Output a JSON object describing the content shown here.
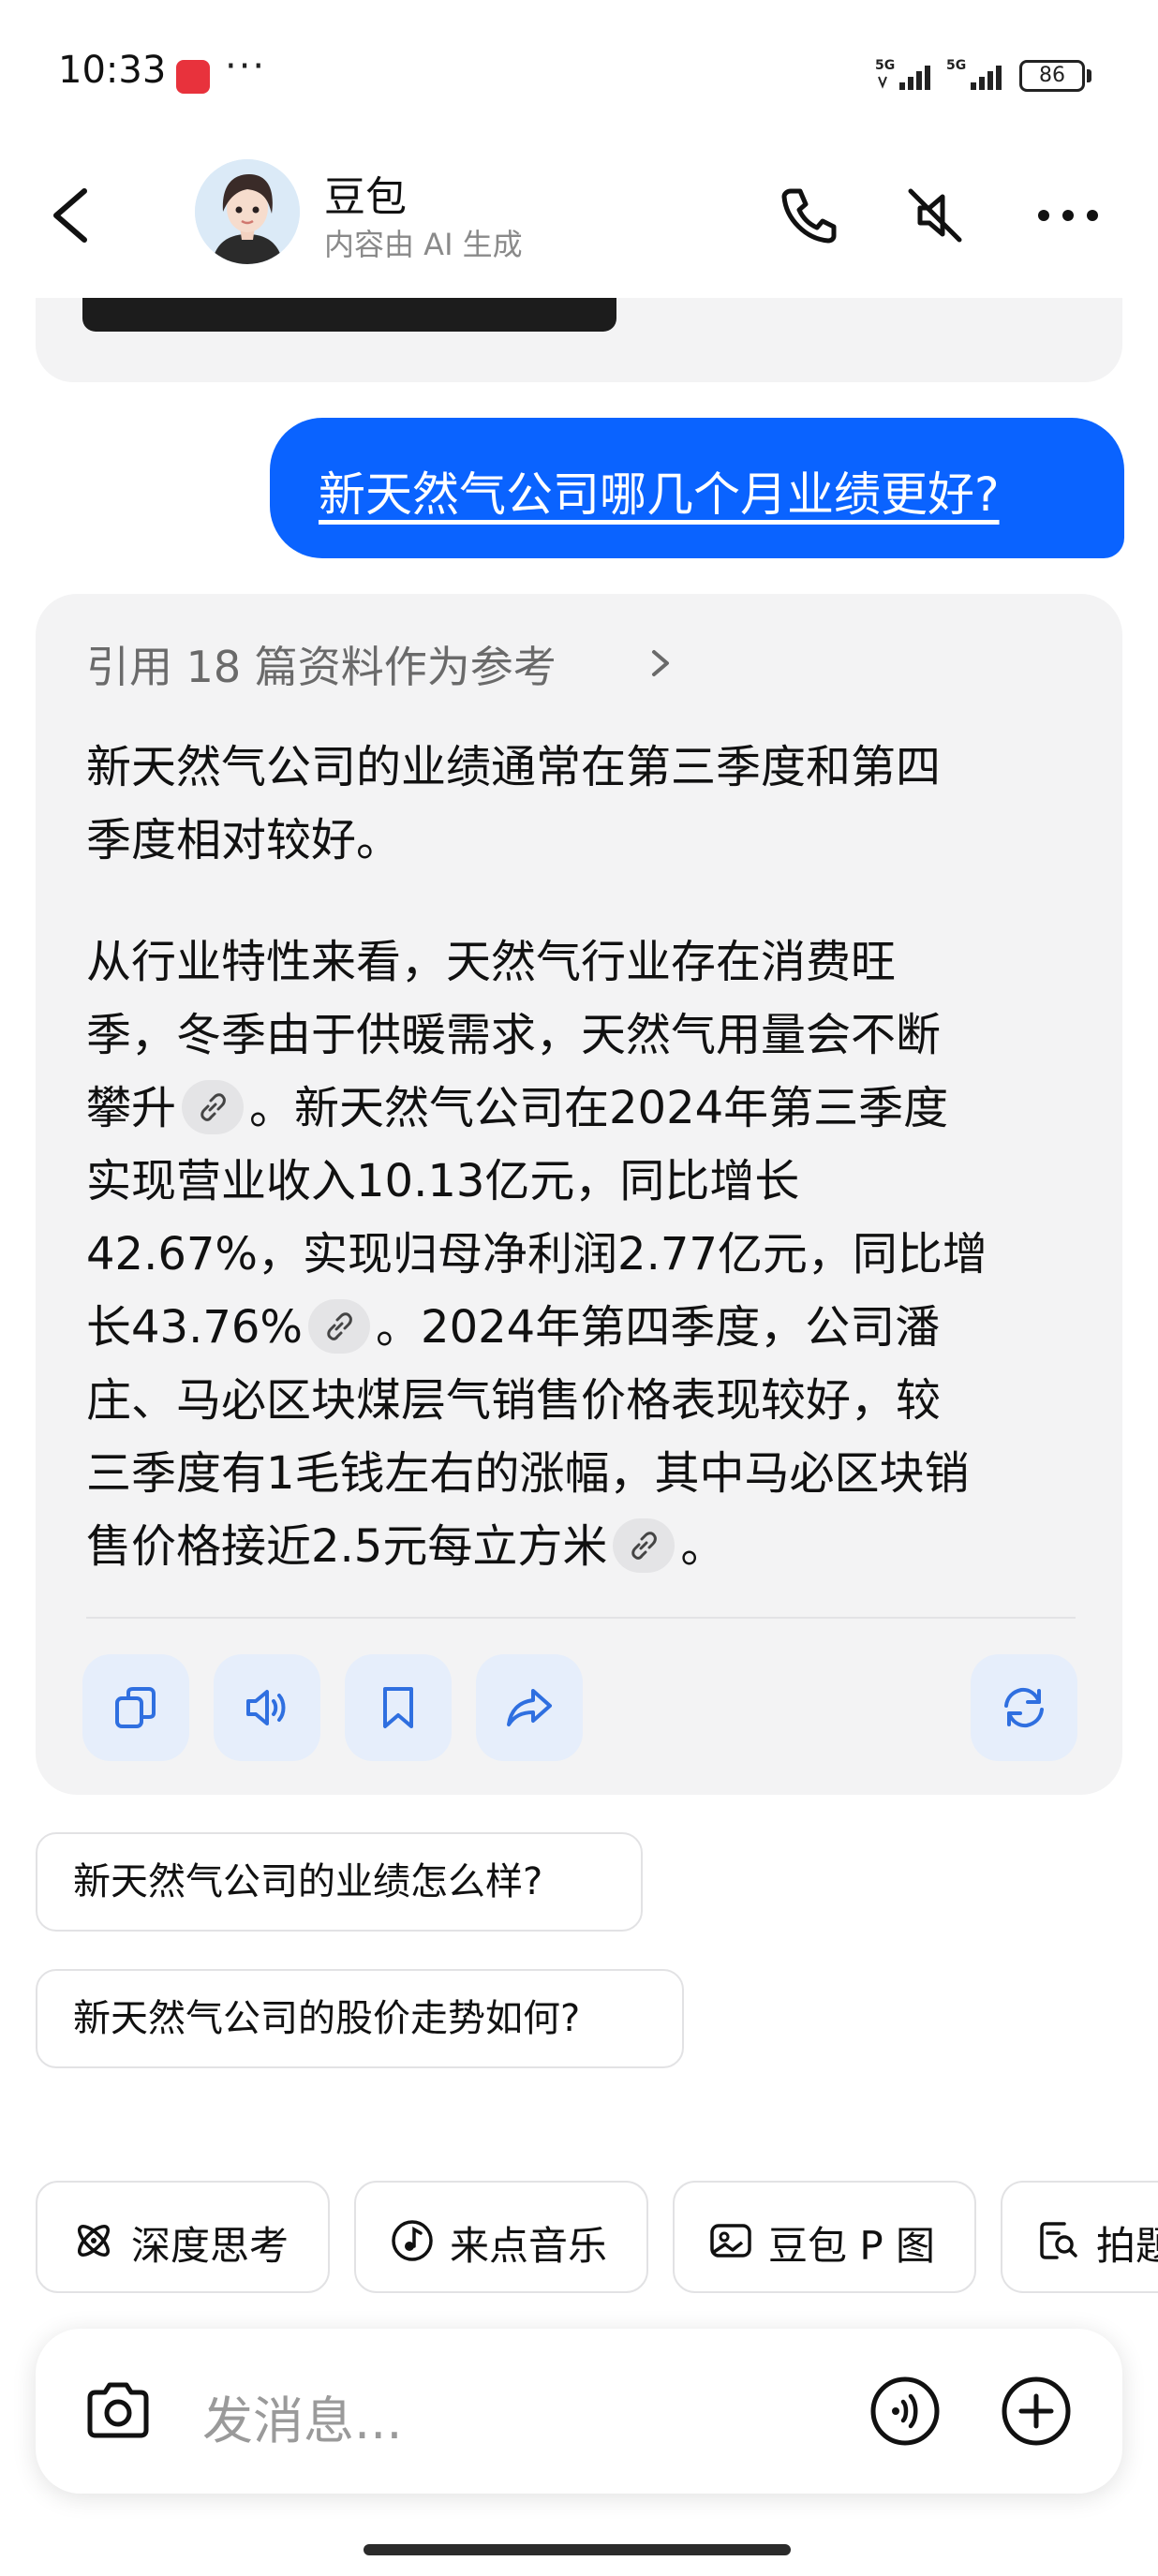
{
  "status_bar": {
    "time": "10:33",
    "dots": "···",
    "signal_1": "5G",
    "signal_2": "5G",
    "battery": "86"
  },
  "header": {
    "name": "豆包",
    "subtitle": "内容由 AI 生成"
  },
  "conversation": {
    "user_message": "新天然气公司哪几个月业绩更好?",
    "reference_line": "引用 18 篇资料作为参考",
    "para1_lines": [
      "新天然气公司的业绩通常在第三季度和第四",
      "季度相对较好。"
    ],
    "para2": {
      "l1": "从行业特性来看，天然气行业存在消费旺",
      "l2": "季，冬季由于供暖需求，天然气用量会不断",
      "l3a": "攀升",
      "l3b": "。新天然气公司在2024年第三季度",
      "l4": "实现营业收入10.13亿元，同比增长",
      "l5": "42.67%，实现归母净利润2.77亿元，同比增",
      "l6a": "长43.76%",
      "l6b": "。2024年第四季度，公司潘",
      "l7": "庄、马必区块煤层气销售价格表现较好，较",
      "l8": "三季度有1毛钱左右的涨幅，其中马必区块销",
      "l9a": "售价格接近2.5元每立方米",
      "l9b": "。"
    }
  },
  "suggestions": [
    "新天然气公司的业绩怎么样?",
    "新天然气公司的股价走势如何?"
  ],
  "tools": [
    {
      "label": "深度思考",
      "icon": "atom-icon"
    },
    {
      "label": "来点音乐",
      "icon": "music-icon"
    },
    {
      "label": "豆包 P 图",
      "icon": "image-edit-icon"
    },
    {
      "label": "拍题",
      "icon": "photo-search-icon"
    }
  ],
  "input": {
    "placeholder": "发消息..."
  },
  "colors": {
    "accent": "#0a63ff",
    "card_bg": "#f3f3f4",
    "action_bg": "#e6eefb",
    "action_icon": "#2f6fe0"
  }
}
